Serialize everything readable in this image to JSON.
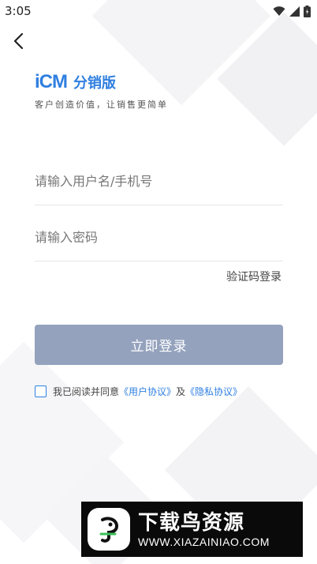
{
  "status_bar": {
    "time": "3:05",
    "icons": [
      "wifi-icon",
      "cellular-icon",
      "battery-icon"
    ]
  },
  "header": {
    "back_icon": "back-arrow-icon"
  },
  "brand": {
    "logo_text": "iCM",
    "product_name": "分销版",
    "slogan": "客户创造价值，让销售更简单",
    "color": "#2f7fe0"
  },
  "form": {
    "username_placeholder": "请输入用户名/手机号",
    "username_value": "",
    "password_placeholder": "请输入密码",
    "password_value": "",
    "code_login_label": "验证码登录",
    "login_button_label": "立即登录",
    "login_button_color": "#94a2bd"
  },
  "agreement": {
    "checked": false,
    "prefix": "我已阅读并同意",
    "user_agreement": "《用户协议》",
    "conjunction": "及",
    "privacy_policy": "《隐私协议》"
  },
  "watermark": {
    "title": "下载鸟资源",
    "url": "WWW.XIAZAINIAO.COM",
    "icon": "bird-logo-icon"
  }
}
